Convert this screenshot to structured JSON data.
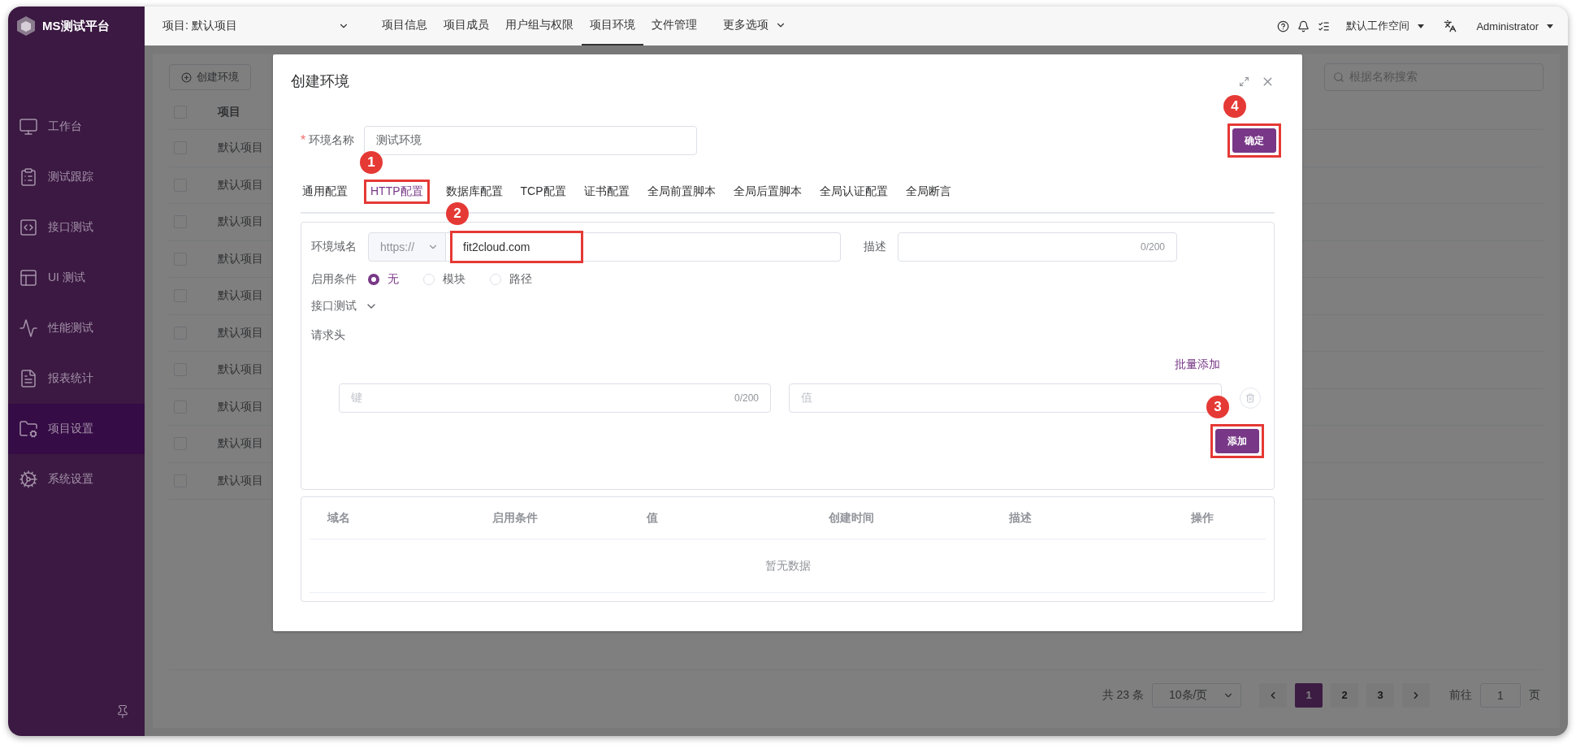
{
  "brand": {
    "name": "MS测试平台"
  },
  "sidebar": {
    "items": [
      {
        "label": "工作台",
        "selected": false
      },
      {
        "label": "测试跟踪",
        "selected": false
      },
      {
        "label": "接口测试",
        "selected": false
      },
      {
        "label": "UI 测试",
        "selected": false
      },
      {
        "label": "性能测试",
        "selected": false
      },
      {
        "label": "报表统计",
        "selected": false
      },
      {
        "label": "项目设置",
        "selected": true
      },
      {
        "label": "系统设置",
        "selected": false
      }
    ]
  },
  "header": {
    "project": "项目: 默认项目",
    "nav": [
      {
        "label": "项目信息",
        "selected": false
      },
      {
        "label": "项目成员",
        "selected": false
      },
      {
        "label": "用户组与权限",
        "selected": false
      },
      {
        "label": "项目环境",
        "selected": true
      },
      {
        "label": "文件管理",
        "selected": false
      }
    ],
    "more": "更多选项",
    "workspace": "默认工作空间",
    "user": "Administrator"
  },
  "page": {
    "create_button": "创建环境",
    "search_placeholder": "根据名称搜索",
    "table": {
      "columns": [
        "项目"
      ],
      "header_checked": false,
      "rows": [
        {
          "label": "默认项目",
          "checked": false
        },
        {
          "label": "默认项目",
          "checked": false
        },
        {
          "label": "默认项目",
          "checked": false
        },
        {
          "label": "默认项目",
          "checked": false
        },
        {
          "label": "默认项目",
          "checked": false
        },
        {
          "label": "默认项目",
          "checked": false
        },
        {
          "label": "默认项目",
          "checked": false
        },
        {
          "label": "默认项目",
          "checked": false
        },
        {
          "label": "默认项目",
          "checked": false
        },
        {
          "label": "默认项目",
          "checked": false
        }
      ]
    },
    "pagination": {
      "total": "共 23 条",
      "page_size": "10条/页",
      "pages": [
        {
          "label": "1",
          "selected": true
        },
        {
          "label": "2",
          "selected": false
        },
        {
          "label": "3",
          "selected": false
        }
      ],
      "goto_label": "前往",
      "goto_value": "1",
      "goto_suffix": "页"
    }
  },
  "dialog": {
    "title": "创建环境",
    "required_mark": "*",
    "name_label": "环境名称",
    "name_value": "测试环境",
    "confirm": "确定",
    "confirm_callout": "4",
    "tabs": [
      {
        "label": "通用配置",
        "selected": false
      },
      {
        "label": "HTTP配置",
        "selected": true,
        "callout": "1"
      },
      {
        "label": "数据库配置",
        "selected": false
      },
      {
        "label": "TCP配置",
        "selected": false
      },
      {
        "label": "证书配置",
        "selected": false
      },
      {
        "label": "全局前置脚本",
        "selected": false
      },
      {
        "label": "全局后置脚本",
        "selected": false
      },
      {
        "label": "全局认证配置",
        "selected": false
      },
      {
        "label": "全局断言",
        "selected": false
      }
    ],
    "domain": {
      "label": "环境域名",
      "protocol": "https://",
      "value": "fit2cloud.com",
      "callout": "2"
    },
    "description": {
      "label": "描述",
      "counter": "0/200"
    },
    "condition": {
      "label": "启用条件",
      "options": [
        {
          "label": "无",
          "selected": true
        },
        {
          "label": "模块",
          "selected": false
        },
        {
          "label": "路径",
          "selected": false
        }
      ]
    },
    "module": "接口测试",
    "headers": {
      "title": "请求头",
      "bulk_add": "批量添加",
      "key_placeholder": "键",
      "key_counter": "0/200",
      "value_placeholder": "值",
      "add": "添加",
      "add_callout": "3"
    },
    "table": {
      "columns": [
        "域名",
        "启用条件",
        "值",
        "创建时间",
        "描述",
        "操作"
      ],
      "empty": "暂无数据"
    }
  }
}
